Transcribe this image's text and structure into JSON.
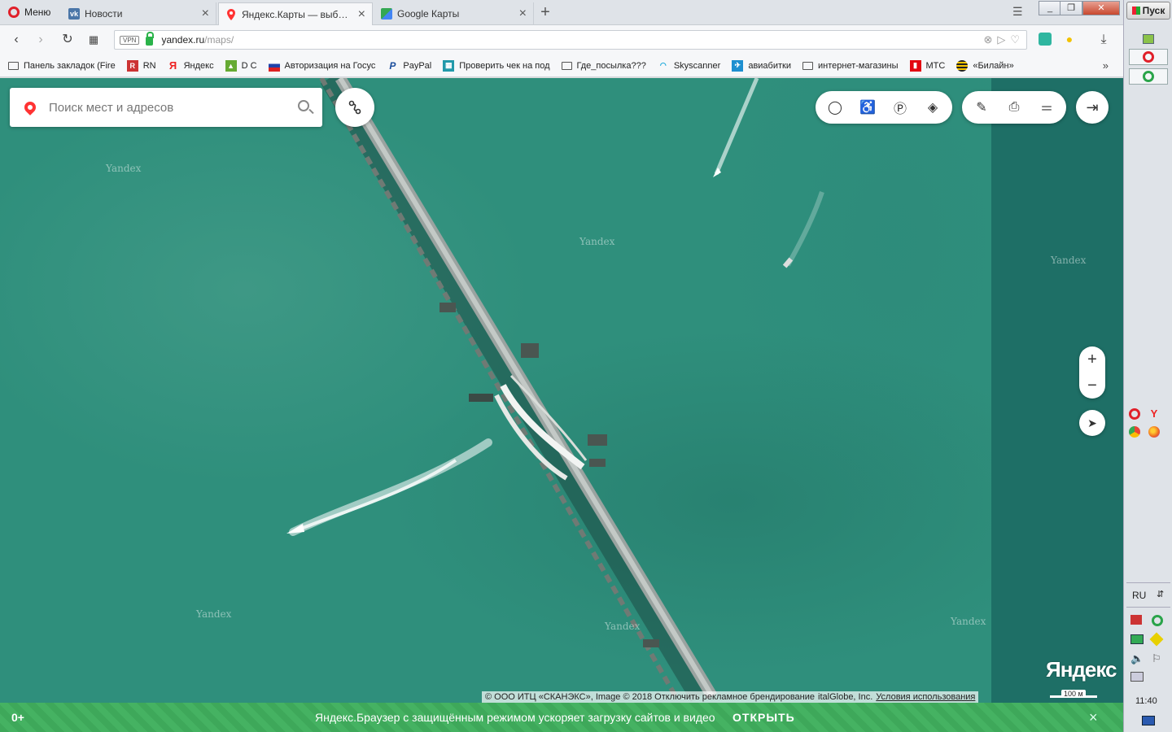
{
  "browser": {
    "menu_label": "Меню",
    "tabs": [
      {
        "title": "Новости",
        "icon": "vk-icon"
      },
      {
        "title": "Яндекс.Карты — выбирайте",
        "icon": "yandex-maps-icon"
      },
      {
        "title": "Google Карты",
        "icon": "google-maps-icon"
      }
    ],
    "new_tab_label": "+",
    "address": {
      "vpn_badge": "VPN",
      "host": "yandex.ru",
      "path": "/maps/"
    },
    "bookmarks": [
      {
        "label": "Панель закладок (Fire",
        "icon": "folder-icon"
      },
      {
        "label": "RN",
        "icon": "rn-icon"
      },
      {
        "label": "Яндекс",
        "icon": "yandex-icon"
      },
      {
        "label": "D C",
        "icon": "dc-icon"
      },
      {
        "label": "Авторизация на Госус",
        "icon": "gosuslugi-icon"
      },
      {
        "label": "PayPal",
        "icon": "paypal-icon"
      },
      {
        "label": "Проверить чек на под",
        "icon": "check-icon"
      },
      {
        "label": "Где_посылка???",
        "icon": "folder-icon"
      },
      {
        "label": "Skyscanner",
        "icon": "skyscanner-icon"
      },
      {
        "label": "авиабитки",
        "icon": "avia-icon"
      },
      {
        "label": "интернет-магазины",
        "icon": "folder-icon"
      },
      {
        "label": "МТС",
        "icon": "mts-icon"
      },
      {
        "label": "«Билайн»",
        "icon": "beeline-icon"
      }
    ],
    "bookmarks_more": "»"
  },
  "map": {
    "search_placeholder": "Поиск мест и адресов",
    "watermark": "Yandex",
    "logo": "Яндекс",
    "attribution": "© ООО ИТЦ «СКАНЭКС», Image © 2018 Отключить рекламное брендирование",
    "attribution_tail": "italGlobe, Inc.",
    "terms_link": "Условия использования",
    "scale_label": "100 м",
    "zoom_in": "+",
    "zoom_out": "−"
  },
  "promo": {
    "age": "0+",
    "text": "Яндекс.Браузер с защищённым режимом ускоряет загрузку сайтов и видео",
    "action": "ОТКРЫТЬ",
    "close": "×"
  },
  "taskbar": {
    "start_label": "Пуск",
    "lang": "RU",
    "clock": "11:40"
  },
  "colors": {
    "sea": "#2f8f7c",
    "promo": "#3ea85a",
    "opera_red": "#e0202a"
  }
}
